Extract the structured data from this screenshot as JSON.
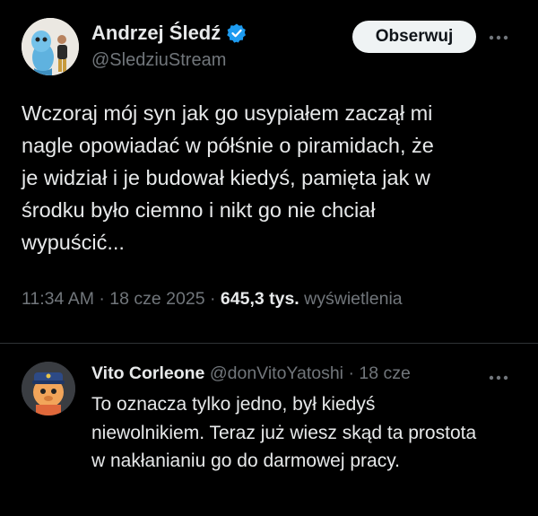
{
  "tweet": {
    "author_name": "Andrzej Śledź",
    "author_handle": "@SledziuStream",
    "follow_label": "Obserwuj",
    "text": "Wczoraj mój syn jak go usypiałem zaczął mi\nnagle opowiadać w półśnie o piramidach, że\nje widział i je budował kiedyś, pamięta jak w\nśrodku było ciemno i nikt go nie chciał\nwypuścić...",
    "time": "11:34 AM",
    "date": "18 cze 2025",
    "views_count": "645,3 tys.",
    "views_label": "wyświetlenia",
    "separator": "·"
  },
  "reply": {
    "author_name": "Vito Corleone",
    "author_handle": "@donVitoYatoshi",
    "date": "18 cze",
    "separator": "·",
    "text": "To oznacza tylko jedno, był kiedyś niewolnikiem. Teraz już wiesz skąd ta prostota w nakłanianiu go do darmowej pracy."
  },
  "icons": {
    "verified": "verified-badge-icon",
    "more": "more-horizontal-icon"
  },
  "colors": {
    "background": "#000000",
    "text_primary": "#e7e9ea",
    "text_secondary": "#71767b",
    "verified": "#1d9bf0",
    "follow_button_bg": "#eff3f4",
    "divider": "#2f3336"
  }
}
